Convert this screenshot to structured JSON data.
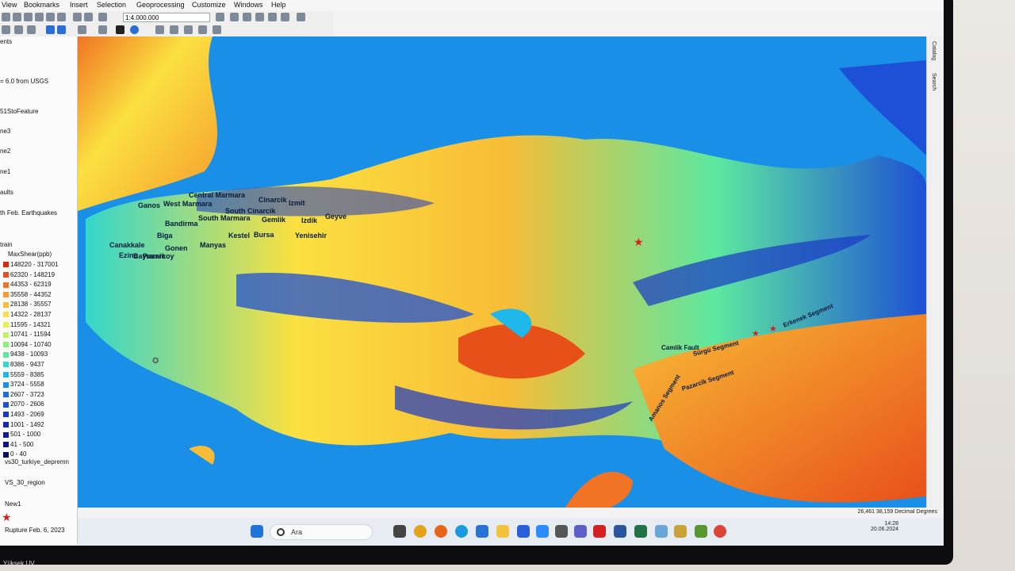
{
  "menu": [
    "View",
    "Bookmarks",
    "Insert",
    "Selection",
    "Geoprocessing",
    "Customize",
    "Windows",
    "Help"
  ],
  "toolbar": {
    "scale": "1:4.000.000"
  },
  "toc": {
    "title": "ents",
    "items": [
      "= 6.0 from USGS",
      "51StoFeature",
      "ne3",
      "ne2",
      "ne1",
      "aults",
      "th Feb. Earthquakes",
      "train",
      "MaxShear(ppb)"
    ],
    "legend": [
      {
        "label": "148220 - 317001",
        "color": "#d92a10"
      },
      {
        "label": "62320 - 148219",
        "color": "#e8501a"
      },
      {
        "label": "44353 - 62319",
        "color": "#f07424"
      },
      {
        "label": "35558 - 44352",
        "color": "#f59a2c"
      },
      {
        "label": "28138 - 35557",
        "color": "#f8bc36"
      },
      {
        "label": "14322 - 28137",
        "color": "#fbe040"
      },
      {
        "label": "11595 - 14321",
        "color": "#e6f04a"
      },
      {
        "label": "10741 - 11594",
        "color": "#bff55a"
      },
      {
        "label": "10094 - 10740",
        "color": "#8bf078"
      },
      {
        "label": "9438 - 10093",
        "color": "#5ce8a0"
      },
      {
        "label": "8386 - 9437",
        "color": "#34d6cc"
      },
      {
        "label": "5559 - 8385",
        "color": "#1fb8ea"
      },
      {
        "label": "3724 - 5558",
        "color": "#1a8fe8"
      },
      {
        "label": "2607 - 3723",
        "color": "#1d6ee0"
      },
      {
        "label": "2070 - 2606",
        "color": "#1d50d6"
      },
      {
        "label": "1493 - 2069",
        "color": "#1a38c6"
      },
      {
        "label": "1001 - 1492",
        "color": "#1626b2"
      },
      {
        "label": "501 - 1000",
        "color": "#121a9a"
      },
      {
        "label": "41 - 500",
        "color": "#0e1482"
      },
      {
        "label": "0 - 40",
        "color": "#0a0f66"
      }
    ],
    "extra": [
      "vs30_turkiye_depremn",
      "VS_30_region",
      "New1",
      "Rupture Feb. 6, 2023"
    ]
  },
  "map": {
    "labels": [
      "Central Marmara",
      "Cinarcik",
      "Izmit",
      "Ganos",
      "West Marmara",
      "South Cinarcik",
      "Gemlik",
      "Izdik",
      "Geyve",
      "South Marmara",
      "Bandirma",
      "Kestel",
      "Bursa",
      "Yenisehir",
      "Biga",
      "Canakkale",
      "Gonen",
      "Manyas",
      "Ezine",
      "Bayramic",
      "Pazarkoy"
    ],
    "fault_labels": [
      "Camlik Fault",
      "Sürgü Segment",
      "Pazarcik Segment",
      "Erkenek Segment",
      "Amanos Segment"
    ]
  },
  "side_tabs": [
    "Catalog",
    "Search"
  ],
  "status": {
    "coords": "26,461  38,159 Decimal Degrees"
  },
  "taskbar": {
    "search": "Ara",
    "time": "14:28",
    "date": "20.06.2024"
  },
  "webcam": "Yüksek UV"
}
